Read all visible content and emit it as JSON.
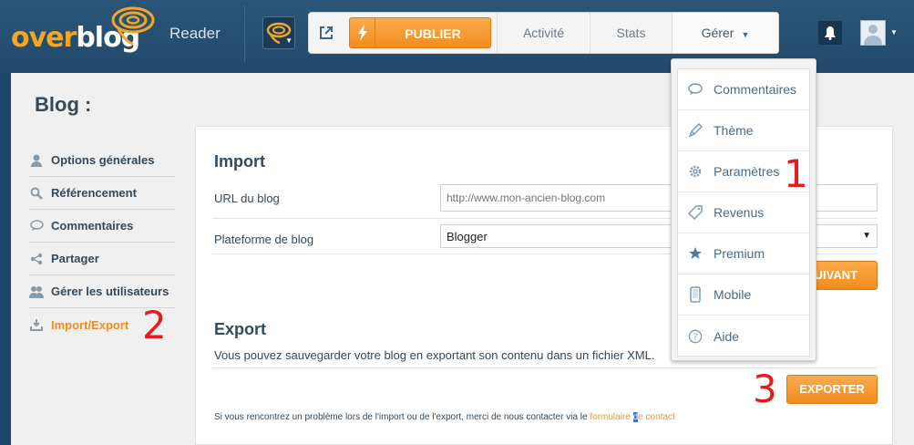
{
  "topbar": {
    "logo_text_a": "over",
    "logo_text_b": "blog",
    "reader_label": "Reader",
    "publish_label": "PUBLIER",
    "nav": [
      {
        "label": "Activité"
      },
      {
        "label": "Stats"
      },
      {
        "label": "Gérer"
      }
    ],
    "icons": {
      "external": "external-link-icon",
      "bolt": "lightning-icon",
      "bell": "bell-icon",
      "avatar": "user-avatar-icon"
    }
  },
  "page": {
    "title": "Blog :",
    "sidebar": [
      {
        "label": "Options générales",
        "icon": "user-icon"
      },
      {
        "label": "Référencement",
        "icon": "search-icon"
      },
      {
        "label": "Commentaires",
        "icon": "comment-icon"
      },
      {
        "label": "Partager",
        "icon": "share-icon"
      },
      {
        "label": "Gérer les utilisateurs",
        "icon": "users-icon"
      },
      {
        "label": "Import/Export",
        "icon": "download-icon",
        "active": true
      }
    ]
  },
  "import": {
    "title": "Import",
    "url_label": "URL du blog",
    "url_placeholder": "http://www.mon-ancien-blog.com",
    "platform_label": "Plateforme de blog",
    "platform_value": "Blogger",
    "next_button": "SUIVANT"
  },
  "export": {
    "title": "Export",
    "description": "Vous pouvez sauvegarder votre blog en exportant son contenu dans un fichier XML.",
    "button": "EXPORTER"
  },
  "footer": {
    "text": "Si vous rencontrez un problème lors de l'import ou de l'export, merci de nous contacter via le ",
    "link_part1": "formulaire ",
    "link_highlight": "d",
    "link_part2": "e contact"
  },
  "dropdown": {
    "items": [
      {
        "label": "Commentaires",
        "icon": "comment-icon"
      },
      {
        "label": "Thème",
        "icon": "brush-icon"
      },
      {
        "label": "Paramètres",
        "icon": "gear-icon"
      },
      {
        "label": "Revenus",
        "icon": "tag-icon"
      },
      {
        "label": "Premium",
        "icon": "star-icon"
      },
      {
        "label": "Mobile",
        "icon": "mobile-icon"
      },
      {
        "label": "Aide",
        "icon": "help-icon"
      }
    ]
  },
  "annotations": {
    "one": "1",
    "two": "2",
    "three": "3"
  },
  "colors": {
    "accent": "#f28c1c",
    "header": "#214a6c",
    "annotation": "#e01e1e"
  }
}
